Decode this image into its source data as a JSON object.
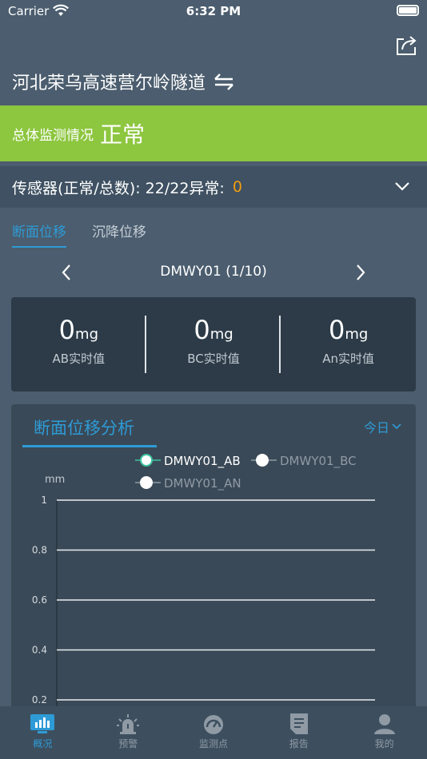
{
  "status_bar": {
    "carrier": "Carrier",
    "time": "6:32 PM"
  },
  "header": {
    "title": "河北荣乌高速营尔岭隧道",
    "share_icon": "share-icon",
    "swap_icon": "swap-icon"
  },
  "overall": {
    "label": "总体监测情况",
    "value": "正常",
    "color": "#8dc63f"
  },
  "sensors": {
    "text": "传感器(正常/总数): 22/22异常:",
    "abnormal": "0",
    "abnormal_color": "#f39c12"
  },
  "tabs": [
    {
      "label": "断面位移",
      "active": true
    },
    {
      "label": "沉降位移",
      "active": false
    }
  ],
  "device": {
    "name": "DMWY01 (1/10)"
  },
  "realtime": [
    {
      "value": "0",
      "unit": "mg",
      "label": "AB实时值"
    },
    {
      "value": "0",
      "unit": "mg",
      "label": "BC实时值"
    },
    {
      "value": "0",
      "unit": "mg",
      "label": "An实时值"
    }
  ],
  "analysis": {
    "title": "断面位移分析",
    "range": "今日",
    "accent": "#2e9bd6"
  },
  "chart_data": {
    "type": "line",
    "ylabel": "mm",
    "yticks": [
      "1",
      "0.8",
      "0.6",
      "0.4",
      "0.2"
    ],
    "ylim": [
      0.2,
      1
    ],
    "grid": true,
    "series": [
      {
        "name": "DMWY01_AB",
        "values": []
      },
      {
        "name": "DMWY01_BC",
        "values": []
      },
      {
        "name": "DMWY01_AN",
        "values": []
      }
    ]
  },
  "tabbar": [
    {
      "label": "概况",
      "icon": "chart-icon",
      "active": true
    },
    {
      "label": "预警",
      "icon": "alarm-icon",
      "active": false
    },
    {
      "label": "监测点",
      "icon": "gauge-icon",
      "active": false
    },
    {
      "label": "报告",
      "icon": "report-icon",
      "active": false
    },
    {
      "label": "我的",
      "icon": "user-icon",
      "active": false
    }
  ]
}
